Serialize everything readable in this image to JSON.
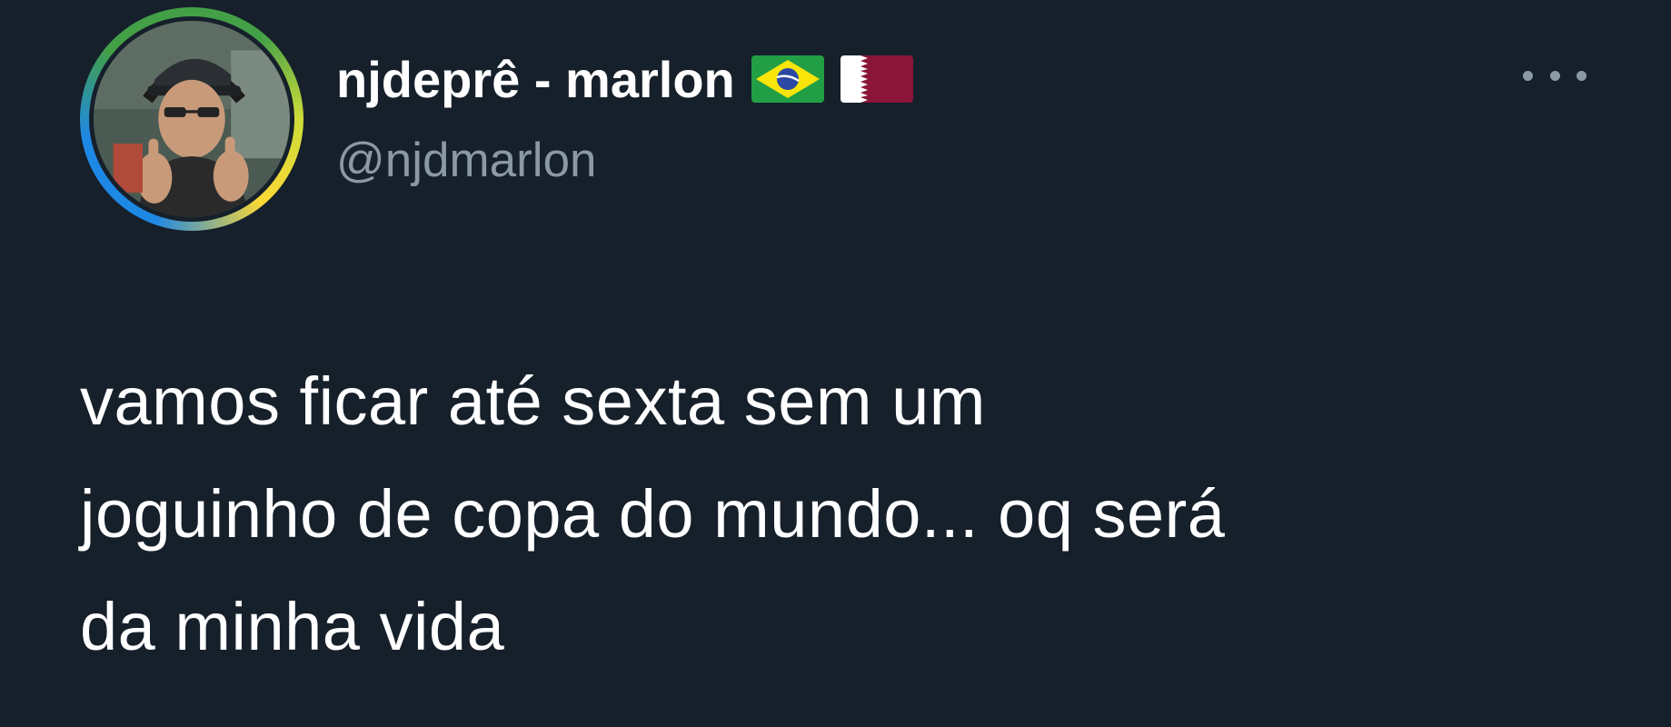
{
  "tweet": {
    "author": {
      "display_name": "njdeprê - marlon",
      "handle": "@njdmarlon",
      "flags": [
        "brazil-flag",
        "qatar-flag"
      ]
    },
    "text_lines": [
      "vamos ficar até sexta sem um",
      "joguinho de copa do mundo... oq será",
      "da minha vida"
    ],
    "more_icon": "more-horizontal-icon"
  },
  "colors": {
    "background": "#16202b",
    "text_primary": "#ffffff",
    "text_secondary": "#8b98a5",
    "avatar_ring": [
      "#1e88e5",
      "#43a047",
      "#fdd835"
    ]
  }
}
